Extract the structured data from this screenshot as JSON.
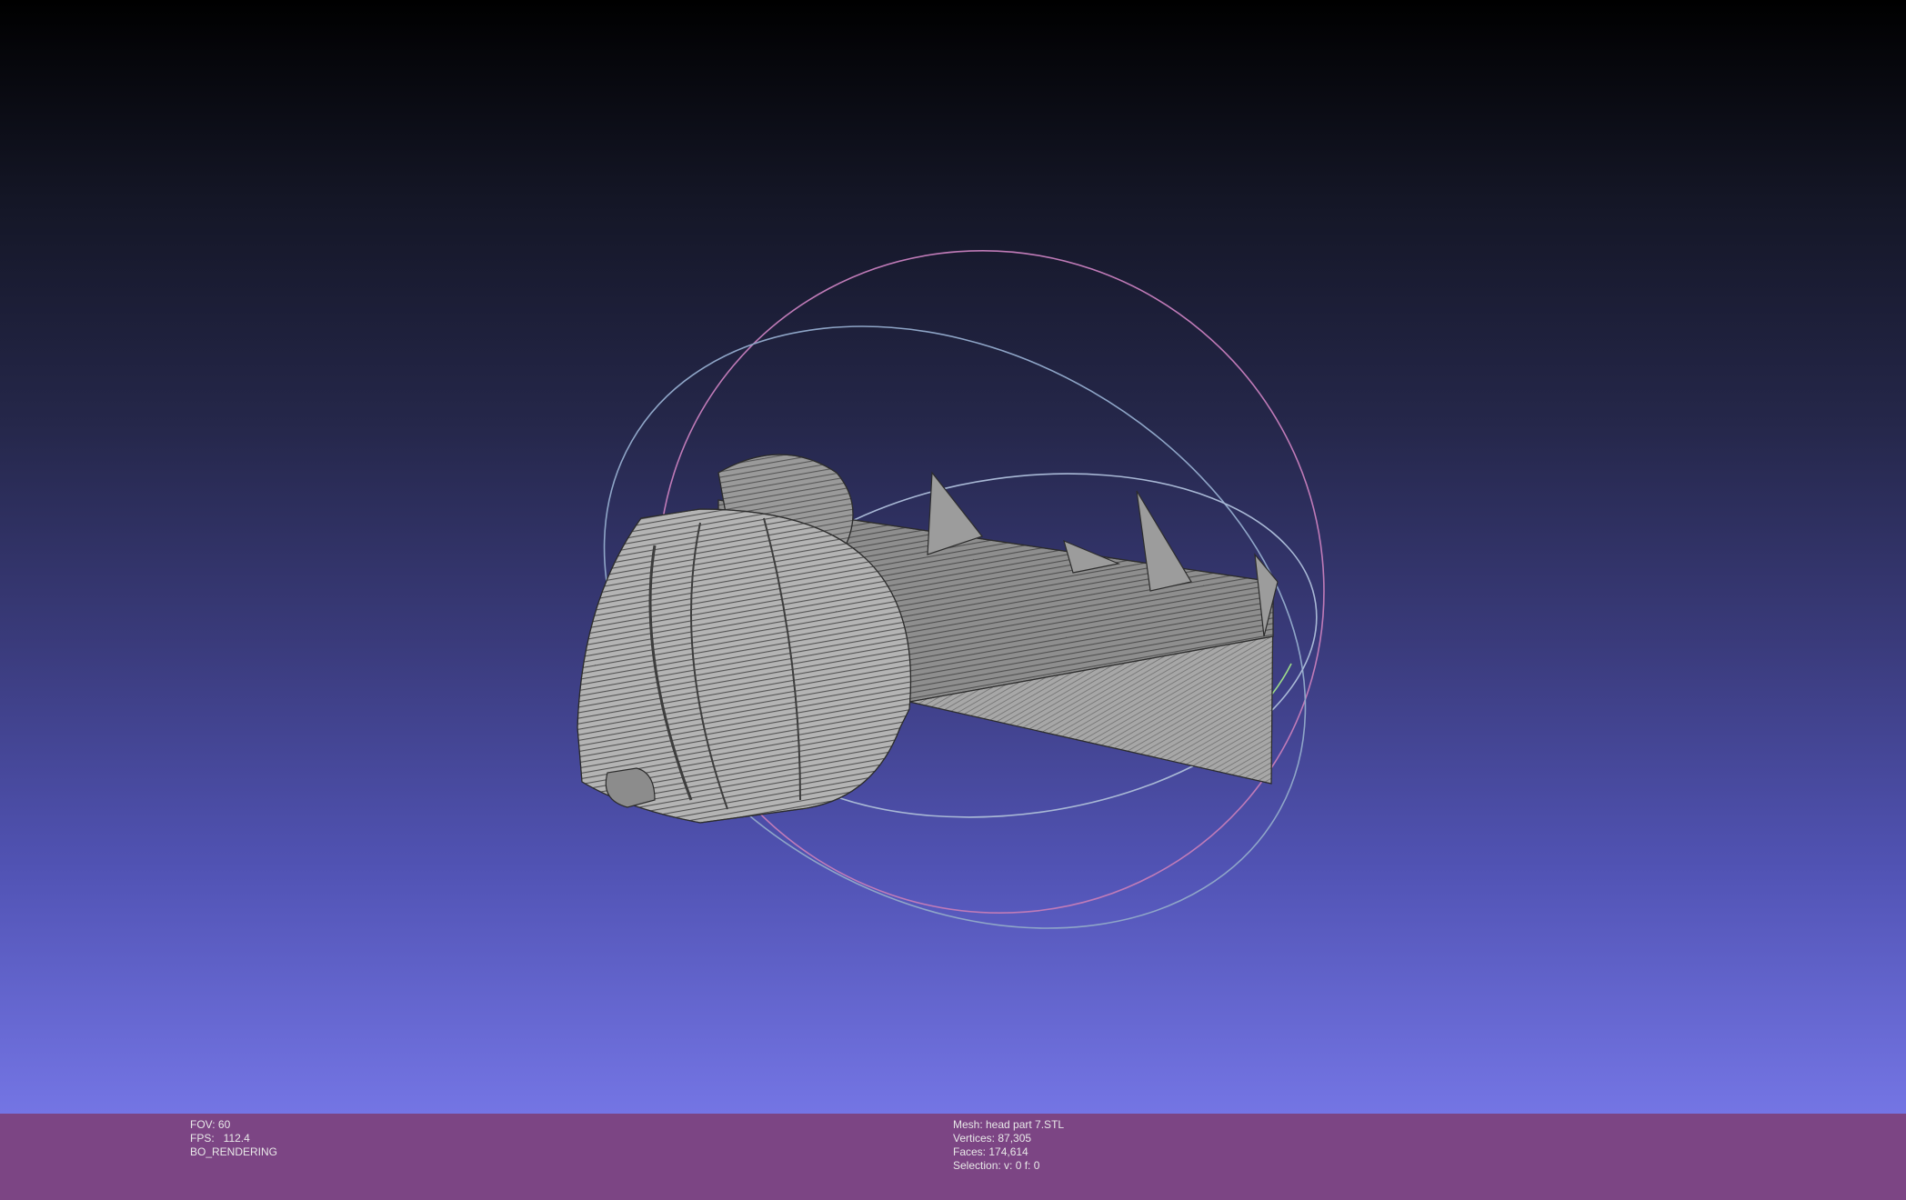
{
  "viewer": {
    "background_top": "#000000",
    "background_bottom": "#7475e4",
    "mesh_color": "#a9a9a9",
    "wire_color": "#3a3a3a",
    "trackball_colors": [
      "#c07bb8",
      "#8fa6c8",
      "#9ddc8a"
    ]
  },
  "info_left": {
    "fov": "FOV: 60",
    "fps": "FPS:   112.4",
    "mode": "BO_RENDERING"
  },
  "info_right": {
    "mesh": "Mesh: head part 7.STL",
    "vertices": "Vertices: 87,305",
    "faces": "Faces: 174,614",
    "selection": "Selection: v: 0 f: 0"
  }
}
